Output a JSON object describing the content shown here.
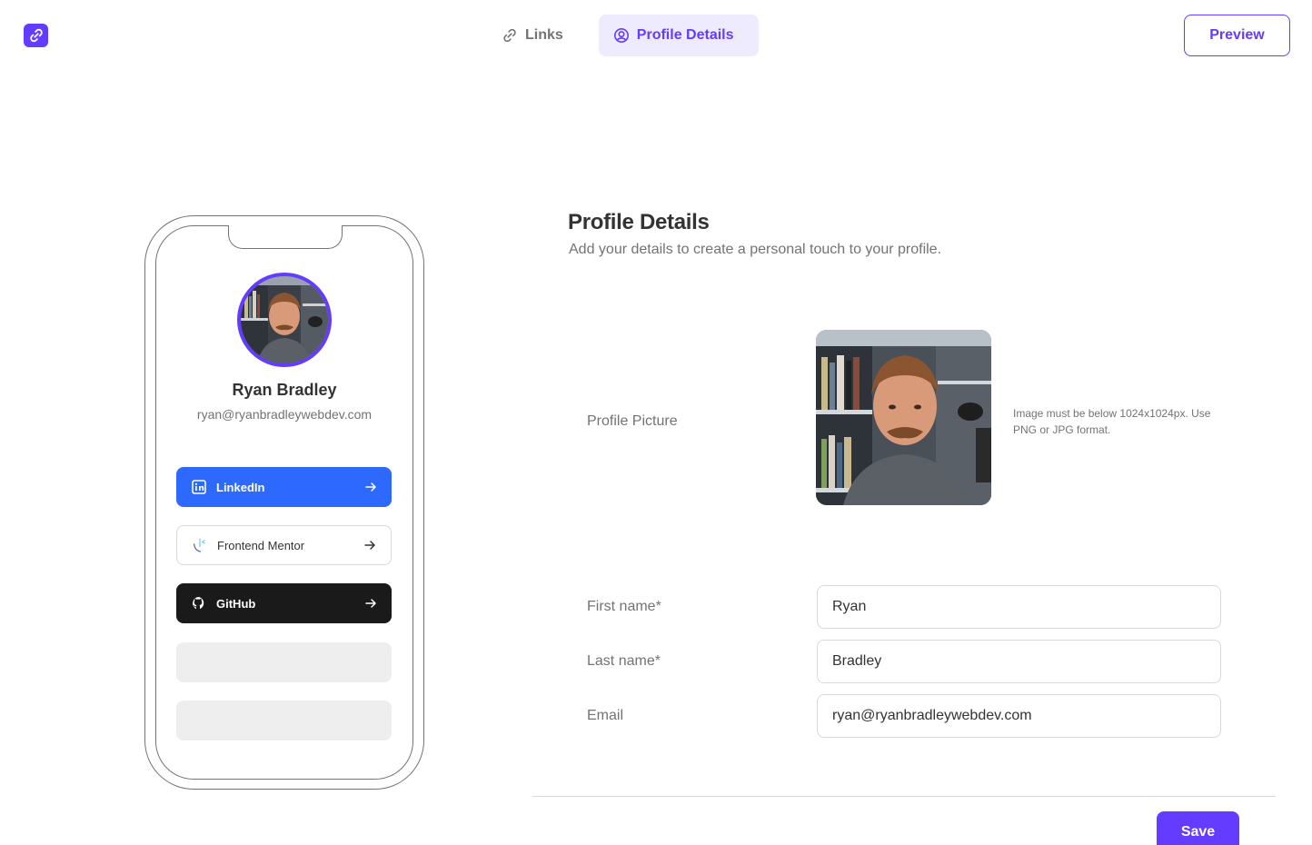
{
  "header": {
    "logo_icon": "link-logo-icon",
    "tabs": [
      {
        "label": "Links",
        "icon": "link-icon",
        "active": false
      },
      {
        "label": "Profile Details",
        "icon": "user-circle-icon",
        "active": true
      }
    ],
    "preview_label": "Preview"
  },
  "phone_preview": {
    "name": "Ryan Bradley",
    "email": "ryan@ryanbradleywebdev.com",
    "links": [
      {
        "label": "LinkedIn",
        "icon": "linkedin-icon",
        "color": "#2d68ff"
      },
      {
        "label": "Frontend Mentor",
        "icon": "frontend-mentor-icon",
        "color": "#ffffff"
      },
      {
        "label": "GitHub",
        "icon": "github-icon",
        "color": "#1a1a1a"
      }
    ]
  },
  "profile": {
    "title": "Profile Details",
    "subtitle": "Add your details to create a personal touch to your profile.",
    "picture_label": "Profile Picture",
    "picture_note": "Image must be below 1024x1024px. Use PNG or JPG format.",
    "fields": {
      "first_name": {
        "label": "First name*",
        "value": "Ryan"
      },
      "last_name": {
        "label": "Last name*",
        "value": "Bradley"
      },
      "email": {
        "label": "Email",
        "value": "ryan@ryanbradleywebdev.com"
      }
    },
    "save_label": "Save"
  },
  "colors": {
    "accent": "#633cff",
    "accent_light": "#efebff",
    "text_dark": "#333333",
    "text_muted": "#737373",
    "border": "#d9d9d9"
  }
}
